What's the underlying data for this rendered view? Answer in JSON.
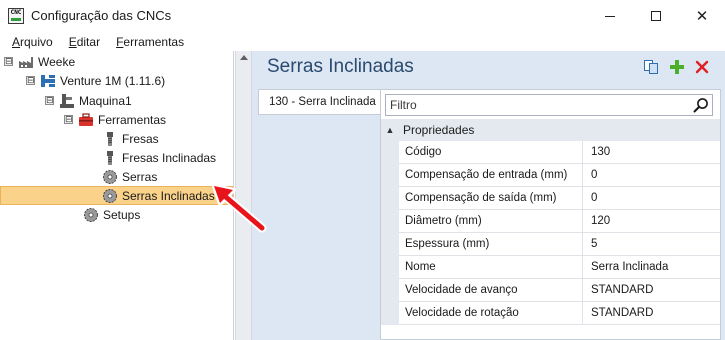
{
  "window": {
    "title": "Configuração das CNCs",
    "app_icon_text": "CNC"
  },
  "menu": {
    "items": [
      {
        "underline": "A",
        "rest": "rquivo"
      },
      {
        "underline": "E",
        "rest": "ditar"
      },
      {
        "underline": "F",
        "rest": "erramentas"
      }
    ]
  },
  "tree": {
    "root": {
      "label": "Weeke",
      "expander": "⊟"
    },
    "machine_group": {
      "label": "Venture 1M (1.11.6)",
      "expander": "⊟"
    },
    "machine": {
      "label": "Maquina1",
      "expander": "⊟"
    },
    "tools": {
      "label": "Ferramentas",
      "expander": "⊟"
    },
    "fresas": {
      "label": "Fresas"
    },
    "fresas_inclinadas": {
      "label": "Fresas Inclinadas"
    },
    "serras": {
      "label": "Serras"
    },
    "serras_inclinadas": {
      "label": "Serras Inclinadas",
      "selected": true
    },
    "setups": {
      "label": "Setups"
    }
  },
  "panel": {
    "title": "Serras Inclinadas",
    "tab_label": "130 - Serra Inclinada",
    "filter_placeholder": "Filtro",
    "category": {
      "label": "Propriedades",
      "toggle": "▲"
    },
    "properties": [
      {
        "name": "Código",
        "value": "130"
      },
      {
        "name": "Compensação de entrada (mm)",
        "value": "0"
      },
      {
        "name": "Compensação de saída (mm)",
        "value": "0"
      },
      {
        "name": "Diâmetro (mm)",
        "value": "120"
      },
      {
        "name": "Espessura (mm)",
        "value": "5"
      },
      {
        "name": "Nome",
        "value": "Serra Inclinada"
      },
      {
        "name": "Velocidade de avanço",
        "value": "STANDARD"
      },
      {
        "name": "Velocidade de rotação",
        "value": "STANDARD"
      }
    ]
  },
  "colors": {
    "selection": "#fbd28a",
    "panel_background": "#dde7f3",
    "title_text": "#2b4a6f",
    "add_icon": "#4caf2a",
    "delete_icon": "#e02020",
    "annotation_arrow": "#e8141c"
  },
  "icons": {
    "copy": "copy-icon",
    "add": "plus-icon",
    "delete": "close-x-icon",
    "search": "magnifier-icon"
  }
}
